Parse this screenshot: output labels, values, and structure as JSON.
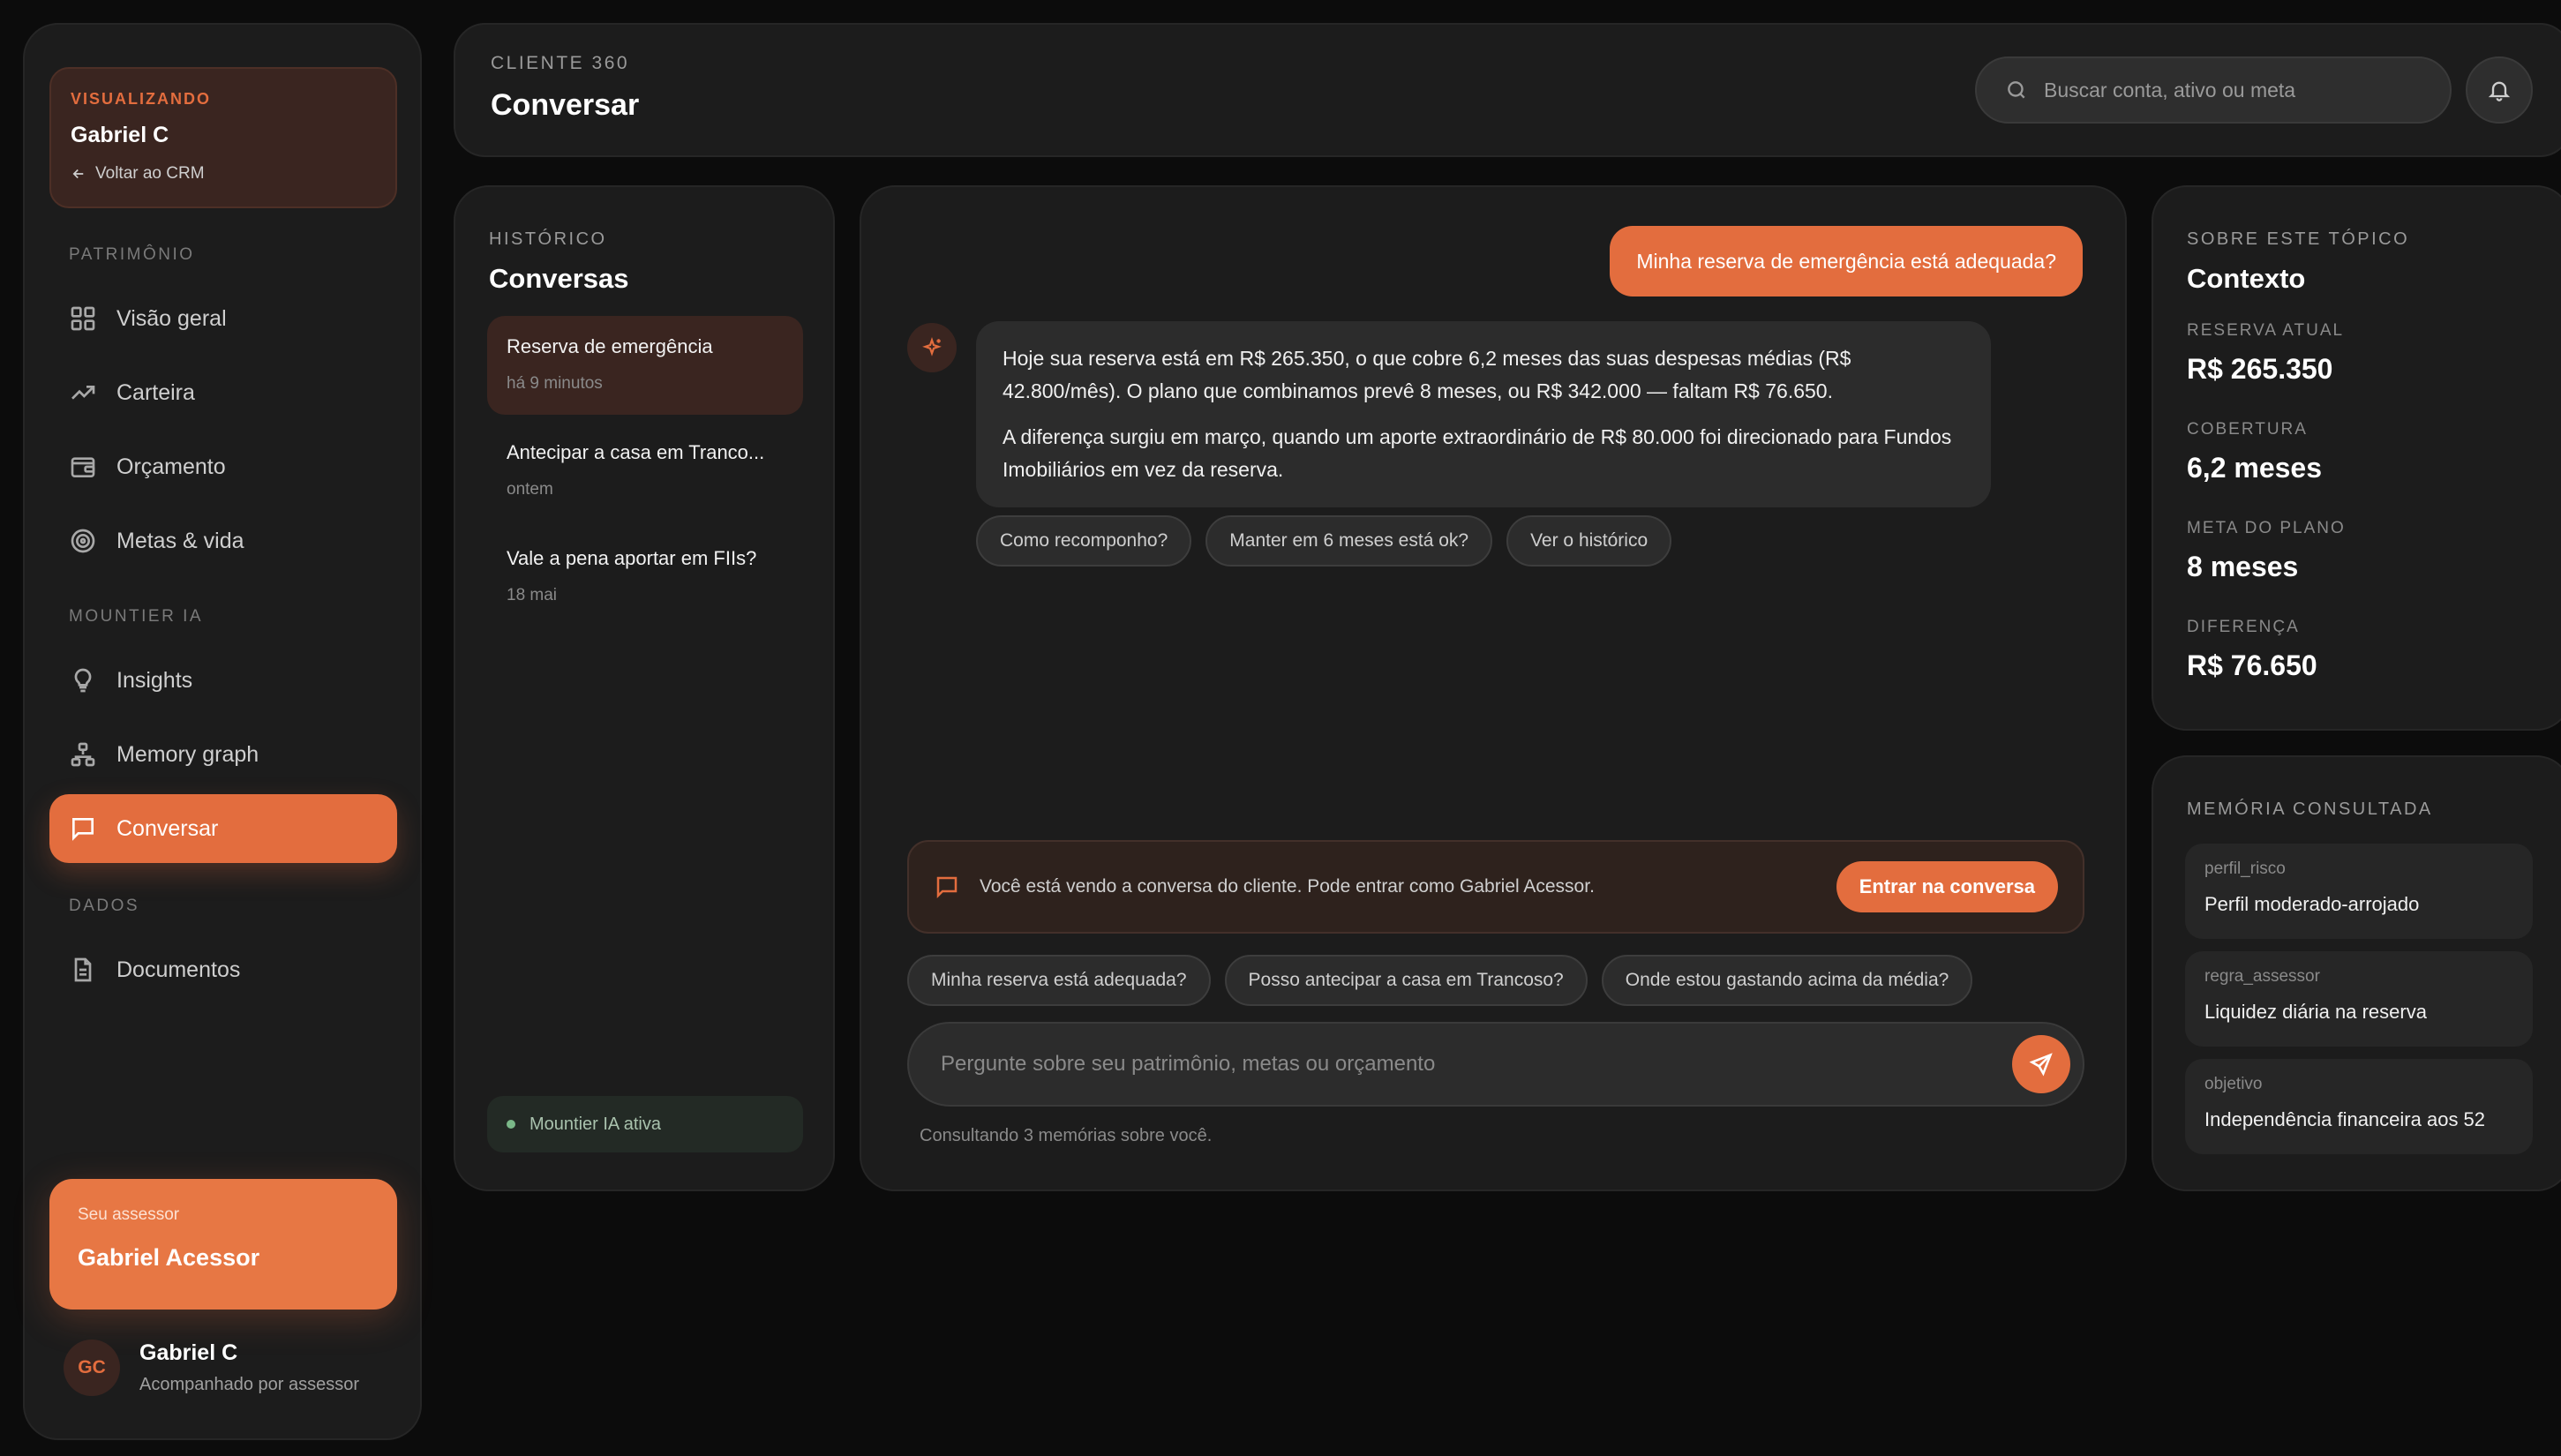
{
  "sidebar": {
    "viewing_label": "VISUALIZANDO",
    "viewing_name": "Gabriel C",
    "back_label": "Voltar ao CRM",
    "section_patrimonio": "PATRIMÔNIO",
    "section_ia": "MOUNTIER IA",
    "section_dados": "DADOS",
    "items": [
      {
        "label": "Visão geral",
        "icon": "grid-icon"
      },
      {
        "label": "Carteira",
        "icon": "trending-up-icon"
      },
      {
        "label": "Orçamento",
        "icon": "wallet-icon"
      },
      {
        "label": "Metas & vida",
        "icon": "target-icon"
      },
      {
        "label": "Insights",
        "icon": "lightbulb-icon"
      },
      {
        "label": "Memory graph",
        "icon": "network-icon"
      },
      {
        "label": "Conversar",
        "icon": "chat-icon",
        "active": true
      },
      {
        "label": "Documentos",
        "icon": "document-icon"
      }
    ],
    "advisor_label": "Seu assessor",
    "advisor_name": "Gabriel Acessor",
    "user_initials": "GC",
    "user_name": "Gabriel C",
    "user_status": "Acompanhado por assessor"
  },
  "header": {
    "subtitle": "CLIENTE 360",
    "title": "Conversar",
    "search_placeholder": "Buscar conta, ativo ou meta"
  },
  "history": {
    "subtitle": "HISTÓRICO",
    "title": "Conversas",
    "conversations": [
      {
        "title": "Reserva de emergência",
        "date": "há 9 minutos",
        "active": true
      },
      {
        "title": "Antecipar a casa em Tranco...",
        "date": "ontem"
      },
      {
        "title": "Vale a pena aportar em FIIs?",
        "date": "18 mai"
      }
    ],
    "status": "Mountier IA ativa"
  },
  "chat": {
    "user_message": "Minha reserva de emergência está adequada?",
    "ai_paragraphs": [
      "Hoje sua reserva está em R$ 265.350, o que cobre 6,2 meses das suas despesas médias (R$ 42.800/mês). O plano que combinamos prevê 8 meses, ou R$ 342.000 — faltam R$ 76.650.",
      "A diferença surgiu em março, quando um aporte extraordinário de R$ 80.000 foi direcionado para Fundos Imobiliários em vez da reserva."
    ],
    "followups": [
      "Como recomponho?",
      "Manter em 6 meses está ok?",
      "Ver o histórico"
    ],
    "notice_text": "Você está vendo a conversa do cliente. Pode entrar como Gabriel Acessor.",
    "notice_button": "Entrar na conversa",
    "suggestions": [
      "Minha reserva está adequada?",
      "Posso antecipar a casa em Trancoso?",
      "Onde estou gastando acima da média?"
    ],
    "input_placeholder": "Pergunte sobre seu patrimônio, metas ou orçamento",
    "consult_text": "Consultando 3 memórias sobre você."
  },
  "context": {
    "subtitle": "SOBRE ESTE TÓPICO",
    "title": "Contexto",
    "items": [
      {
        "label": "RESERVA ATUAL",
        "value": "R$ 265.350"
      },
      {
        "label": "COBERTURA",
        "value": "6,2 meses"
      },
      {
        "label": "META DO PLANO",
        "value": "8 meses"
      },
      {
        "label": "DIFERENÇA",
        "value": "R$ 76.650"
      }
    ]
  },
  "memory": {
    "subtitle": "MEMÓRIA CONSULTADA",
    "items": [
      {
        "key": "perfil_risco",
        "value": "Perfil moderado-arrojado"
      },
      {
        "key": "regra_assessor",
        "value": "Liquidez diária na reserva"
      },
      {
        "key": "objetivo",
        "value": "Independência financeira aos 52"
      }
    ]
  },
  "colors": {
    "accent": "#e36d3e",
    "background": "#0c0c0c",
    "panel": "#1c1c1c"
  }
}
